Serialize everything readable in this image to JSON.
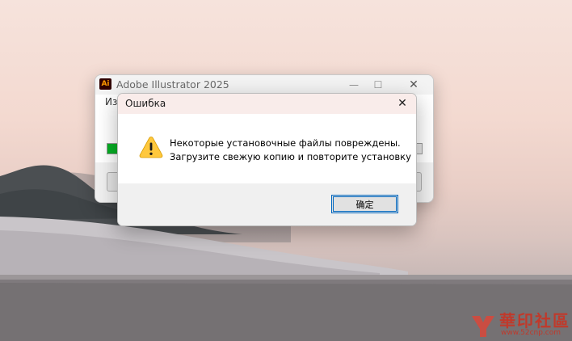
{
  "installer": {
    "logo_text": "Ai",
    "title": "Adobe Illustrator 2025",
    "minimize": "—",
    "maximize": "☐",
    "close": "✕",
    "label_partial": "Из",
    "progress_fraction": 0.97,
    "progress_color": "#06b025"
  },
  "dialog": {
    "title": "Ошибка",
    "close": "✕",
    "icon": "warning-icon",
    "message_line1": "Некоторые установочные файлы повреждены.",
    "message_line2": "Загрузите свежую копию и повторите установку",
    "ok_label": "确定",
    "accent_color": "#0067c0"
  },
  "watermark": {
    "logo_text": "華印社區",
    "url": "www.52cnp.com"
  }
}
